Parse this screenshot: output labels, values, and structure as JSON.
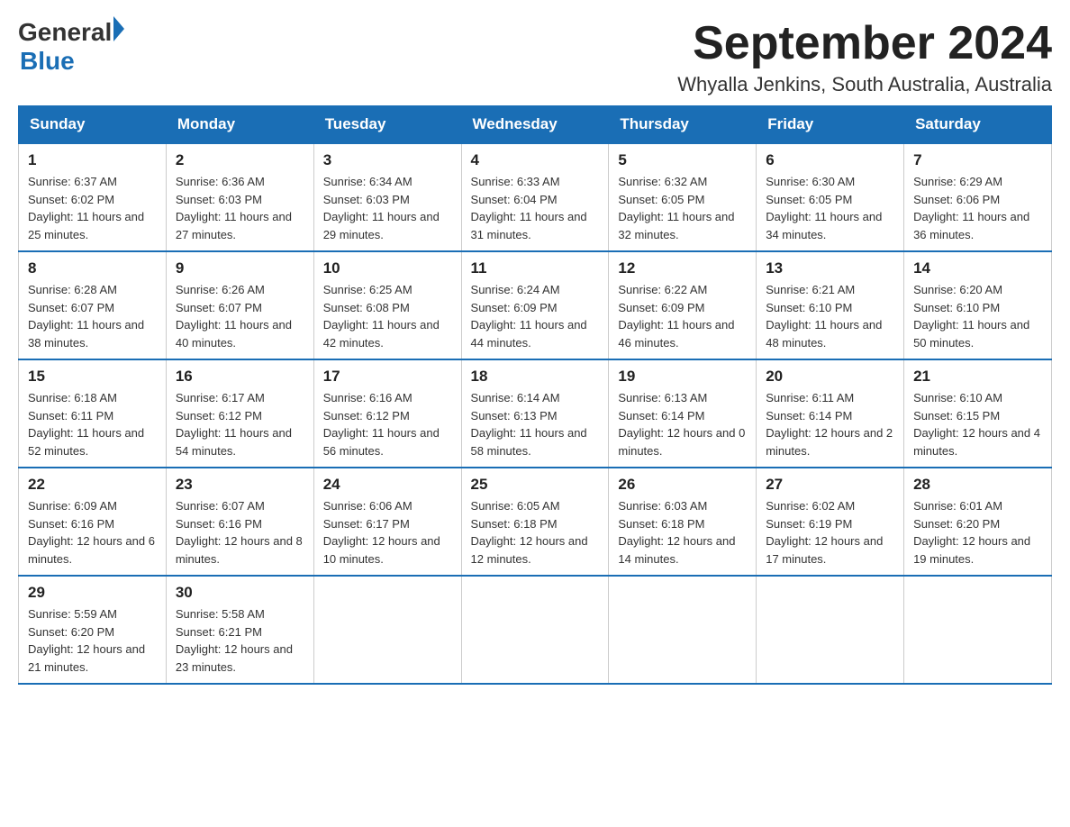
{
  "logo": {
    "general": "General",
    "blue": "Blue",
    "arrow": "▶"
  },
  "title": "September 2024",
  "location": "Whyalla Jenkins, South Australia, Australia",
  "headers": [
    "Sunday",
    "Monday",
    "Tuesday",
    "Wednesday",
    "Thursday",
    "Friday",
    "Saturday"
  ],
  "weeks": [
    [
      {
        "day": "1",
        "sunrise": "6:37 AM",
        "sunset": "6:02 PM",
        "daylight": "11 hours and 25 minutes."
      },
      {
        "day": "2",
        "sunrise": "6:36 AM",
        "sunset": "6:03 PM",
        "daylight": "11 hours and 27 minutes."
      },
      {
        "day": "3",
        "sunrise": "6:34 AM",
        "sunset": "6:03 PM",
        "daylight": "11 hours and 29 minutes."
      },
      {
        "day": "4",
        "sunrise": "6:33 AM",
        "sunset": "6:04 PM",
        "daylight": "11 hours and 31 minutes."
      },
      {
        "day": "5",
        "sunrise": "6:32 AM",
        "sunset": "6:05 PM",
        "daylight": "11 hours and 32 minutes."
      },
      {
        "day": "6",
        "sunrise": "6:30 AM",
        "sunset": "6:05 PM",
        "daylight": "11 hours and 34 minutes."
      },
      {
        "day": "7",
        "sunrise": "6:29 AM",
        "sunset": "6:06 PM",
        "daylight": "11 hours and 36 minutes."
      }
    ],
    [
      {
        "day": "8",
        "sunrise": "6:28 AM",
        "sunset": "6:07 PM",
        "daylight": "11 hours and 38 minutes."
      },
      {
        "day": "9",
        "sunrise": "6:26 AM",
        "sunset": "6:07 PM",
        "daylight": "11 hours and 40 minutes."
      },
      {
        "day": "10",
        "sunrise": "6:25 AM",
        "sunset": "6:08 PM",
        "daylight": "11 hours and 42 minutes."
      },
      {
        "day": "11",
        "sunrise": "6:24 AM",
        "sunset": "6:09 PM",
        "daylight": "11 hours and 44 minutes."
      },
      {
        "day": "12",
        "sunrise": "6:22 AM",
        "sunset": "6:09 PM",
        "daylight": "11 hours and 46 minutes."
      },
      {
        "day": "13",
        "sunrise": "6:21 AM",
        "sunset": "6:10 PM",
        "daylight": "11 hours and 48 minutes."
      },
      {
        "day": "14",
        "sunrise": "6:20 AM",
        "sunset": "6:10 PM",
        "daylight": "11 hours and 50 minutes."
      }
    ],
    [
      {
        "day": "15",
        "sunrise": "6:18 AM",
        "sunset": "6:11 PM",
        "daylight": "11 hours and 52 minutes."
      },
      {
        "day": "16",
        "sunrise": "6:17 AM",
        "sunset": "6:12 PM",
        "daylight": "11 hours and 54 minutes."
      },
      {
        "day": "17",
        "sunrise": "6:16 AM",
        "sunset": "6:12 PM",
        "daylight": "11 hours and 56 minutes."
      },
      {
        "day": "18",
        "sunrise": "6:14 AM",
        "sunset": "6:13 PM",
        "daylight": "11 hours and 58 minutes."
      },
      {
        "day": "19",
        "sunrise": "6:13 AM",
        "sunset": "6:14 PM",
        "daylight": "12 hours and 0 minutes."
      },
      {
        "day": "20",
        "sunrise": "6:11 AM",
        "sunset": "6:14 PM",
        "daylight": "12 hours and 2 minutes."
      },
      {
        "day": "21",
        "sunrise": "6:10 AM",
        "sunset": "6:15 PM",
        "daylight": "12 hours and 4 minutes."
      }
    ],
    [
      {
        "day": "22",
        "sunrise": "6:09 AM",
        "sunset": "6:16 PM",
        "daylight": "12 hours and 6 minutes."
      },
      {
        "day": "23",
        "sunrise": "6:07 AM",
        "sunset": "6:16 PM",
        "daylight": "12 hours and 8 minutes."
      },
      {
        "day": "24",
        "sunrise": "6:06 AM",
        "sunset": "6:17 PM",
        "daylight": "12 hours and 10 minutes."
      },
      {
        "day": "25",
        "sunrise": "6:05 AM",
        "sunset": "6:18 PM",
        "daylight": "12 hours and 12 minutes."
      },
      {
        "day": "26",
        "sunrise": "6:03 AM",
        "sunset": "6:18 PM",
        "daylight": "12 hours and 14 minutes."
      },
      {
        "day": "27",
        "sunrise": "6:02 AM",
        "sunset": "6:19 PM",
        "daylight": "12 hours and 17 minutes."
      },
      {
        "day": "28",
        "sunrise": "6:01 AM",
        "sunset": "6:20 PM",
        "daylight": "12 hours and 19 minutes."
      }
    ],
    [
      {
        "day": "29",
        "sunrise": "5:59 AM",
        "sunset": "6:20 PM",
        "daylight": "12 hours and 21 minutes."
      },
      {
        "day": "30",
        "sunrise": "5:58 AM",
        "sunset": "6:21 PM",
        "daylight": "12 hours and 23 minutes."
      },
      null,
      null,
      null,
      null,
      null
    ]
  ]
}
